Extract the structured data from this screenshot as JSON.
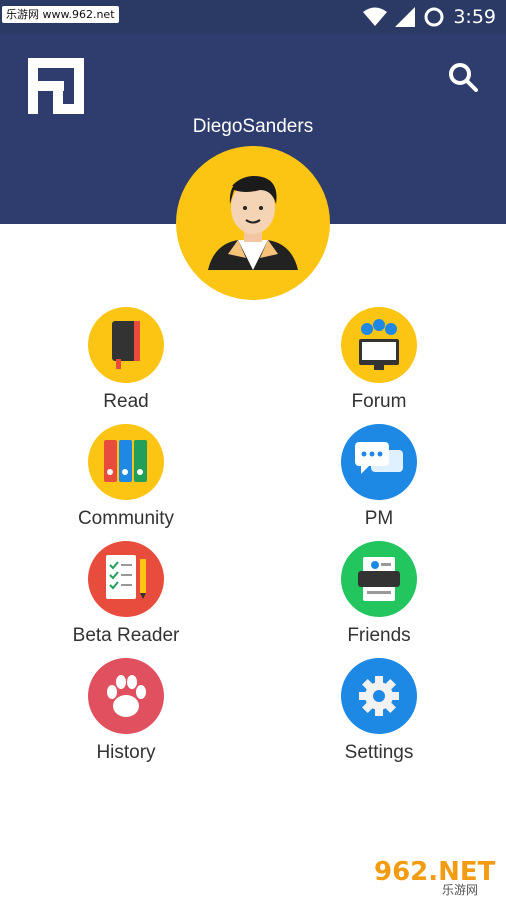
{
  "status_bar": {
    "time": "3:59",
    "watermark": "乐游网 www.962.net"
  },
  "header": {
    "username": "DiegoSanders"
  },
  "menu": [
    {
      "label": "Read",
      "icon": "notebook-icon"
    },
    {
      "label": "Forum",
      "icon": "forum-monitor-icon"
    },
    {
      "label": "Community",
      "icon": "binders-icon"
    },
    {
      "label": "PM",
      "icon": "chat-bubbles-icon"
    },
    {
      "label": "Beta Reader",
      "icon": "checklist-pencil-icon"
    },
    {
      "label": "Friends",
      "icon": "contacts-icon"
    },
    {
      "label": "History",
      "icon": "paw-icon"
    },
    {
      "label": "Settings",
      "icon": "gear-icon"
    }
  ],
  "footer_watermark": {
    "brand": "962.NET",
    "sub": "乐游网"
  },
  "colors": {
    "header": "#2f3d6e",
    "status_bar": "#2b3a64",
    "yellow": "#fdc513",
    "blue": "#1e88e5",
    "red": "#e84c3d",
    "green": "#22c55e",
    "crimson": "#e0505f"
  }
}
